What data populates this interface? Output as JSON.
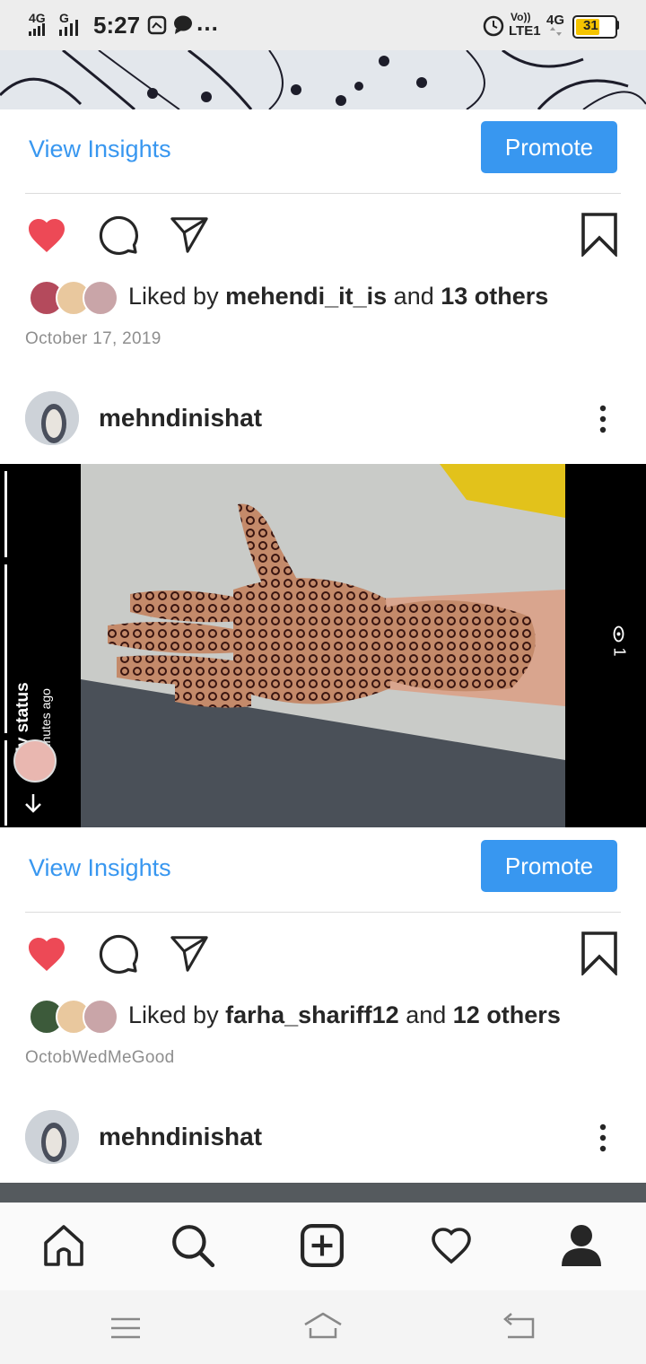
{
  "status_bar": {
    "signal1": "4G",
    "signal2": "G",
    "time": "5:27",
    "more": "…",
    "volte": "Vo))",
    "lte": "LTE1",
    "net": "4G",
    "battery": "31"
  },
  "post1": {
    "insights_label": "View Insights",
    "promote_label": "Promote",
    "liked_prefix": "Liked by",
    "liked_user": "mehendi_it_is",
    "liked_and": "and",
    "liked_others": "13 others",
    "date": "October 17, 2019"
  },
  "post2": {
    "username": "mehndinishat",
    "story": {
      "title": "My status",
      "subtitle": "5 minutes ago",
      "views": "1"
    },
    "insights_label": "View Insights",
    "promote_label": "Promote",
    "liked_prefix": "Liked by",
    "liked_user": "farha_shariff12",
    "liked_and": "and",
    "liked_others": "12 others",
    "date": "OctobWedMeGood"
  },
  "post3": {
    "username": "mehndinishat"
  },
  "icons": {
    "like": "heart-filled-icon",
    "comment": "comment-icon",
    "share": "paper-plane-icon",
    "save": "bookmark-icon",
    "more": "more-vertical-icon",
    "nav": [
      "home-icon",
      "search-icon",
      "add-post-icon",
      "activity-heart-icon",
      "profile-icon"
    ],
    "system": [
      "menu-icon",
      "home-key-icon",
      "back-icon"
    ]
  },
  "colors": {
    "accent": "#3897f0",
    "like": "#ed4956",
    "battery": "#f5c400"
  }
}
